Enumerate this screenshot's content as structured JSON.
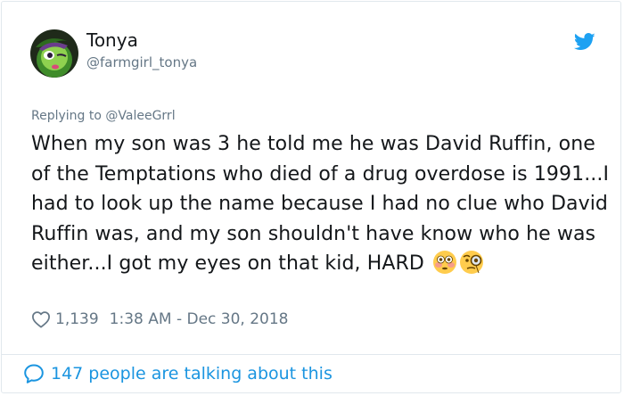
{
  "user": {
    "name": "Tonya",
    "handle": "@farmgirl_tonya"
  },
  "reply": {
    "prefix": "Replying to",
    "mention": "@ValeeGrrl"
  },
  "tweet": {
    "text": "When my son was 3 he told me he was David Ruffin, one of the Temptations who died of a drug overdose is 1991...I had to look up the name because I had no clue who David Ruffin was, and my son shouldn't have know who he was either...I got my eyes on that kid, HARD",
    "emojis": [
      "flushed-face",
      "face-with-monocle"
    ]
  },
  "meta": {
    "likes": "1,139",
    "timestamp": "1:38 AM - Dec 30, 2018"
  },
  "footer": {
    "label": "147 people are talking about this"
  },
  "icons": {
    "brand": "twitter-bird-icon",
    "like": "heart-icon",
    "conversation": "speech-bubble-icon"
  },
  "colors": {
    "twitter_blue": "#1da1f2",
    "link_blue": "#1b95e0",
    "secondary_text": "#657786",
    "border": "#e1e8ed"
  }
}
